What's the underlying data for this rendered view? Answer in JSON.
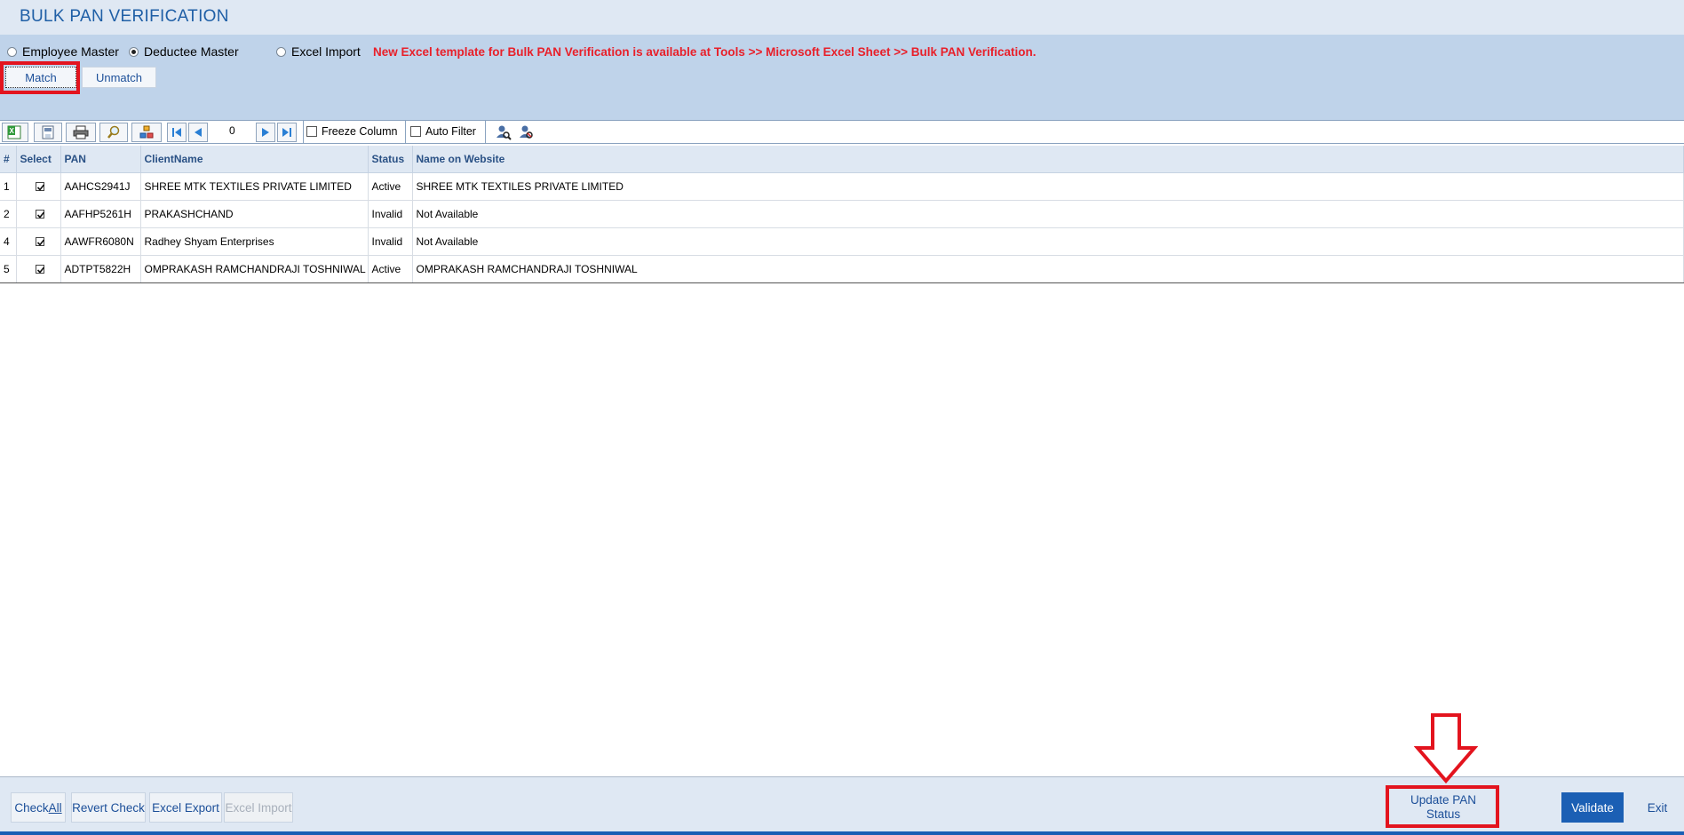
{
  "window": {
    "title": "BULK PAN VERIFICATION"
  },
  "options": {
    "radios": [
      {
        "label": "Employee Master",
        "selected": false
      },
      {
        "label": "Deductee Master",
        "selected": true
      },
      {
        "label": "Excel Import",
        "selected": false
      }
    ],
    "notice": "New Excel template for Bulk PAN Verification is available at Tools >> Microsoft Excel Sheet >> Bulk PAN Verification.",
    "match_label": "Match",
    "unmatch_label": "Unmatch"
  },
  "toolbar": {
    "icons": [
      "excel-export-icon",
      "save-icon",
      "print-icon",
      "find-icon",
      "group-icon",
      "first-page-icon",
      "previous-page-icon",
      "next-page-icon",
      "last-page-icon",
      "search-user-icon",
      "clear-search-icon"
    ],
    "record_count": "0",
    "freeze_column_label": "Freeze Column",
    "auto_filter_label": "Auto Filter"
  },
  "grid": {
    "columns": [
      "#",
      "Select",
      "PAN",
      "ClientName",
      "Status",
      "Name on Website"
    ],
    "rows": [
      {
        "num": "1",
        "selected": true,
        "pan": "AAHCS2941J",
        "client": "SHREE MTK TEXTILES PRIVATE LIMITED",
        "status": "Active",
        "website": "SHREE MTK TEXTILES PRIVATE LIMITED"
      },
      {
        "num": "2",
        "selected": true,
        "pan": "AAFHP5261H",
        "client": "PRAKASHCHAND",
        "status": "Invalid",
        "website": "Not Available"
      },
      {
        "num": "4",
        "selected": true,
        "pan": "AAWFR6080N",
        "client": "Radhey Shyam Enterprises",
        "status": "Invalid",
        "website": "Not Available"
      },
      {
        "num": "5",
        "selected": true,
        "pan": "ADTPT5822H",
        "client": "OMPRAKASH RAMCHANDRAJI TOSHNIWAL",
        "status": "Active",
        "website": "OMPRAKASH RAMCHANDRAJI TOSHNIWAL"
      }
    ]
  },
  "footer": {
    "check_all_prefix": "Check ",
    "check_all_accel": "All",
    "revert_check": "Revert Check",
    "excel_export": "Excel Export",
    "excel_import": "Excel Import",
    "update_pan_line1": "Update PAN",
    "update_pan_line2": "Status",
    "validate": "Validate",
    "exit": "Exit"
  },
  "colors": {
    "highlight": "#e3141e",
    "accent": "#1b5fb4",
    "notice": "#e8202a"
  }
}
